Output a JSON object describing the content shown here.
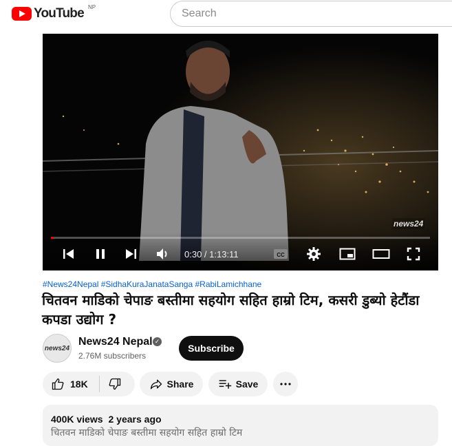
{
  "header": {
    "logo_text": "YouTube",
    "country_code": "NP",
    "search_placeholder": "Search"
  },
  "player": {
    "time_display": "0:30 / 1:13:11",
    "progress_fraction": 0.007,
    "watermark": "news24",
    "controls": [
      "previous-icon",
      "pause-icon",
      "next-icon",
      "volume-icon",
      "captions-icon",
      "settings-icon",
      "miniplayer-icon",
      "theater-icon",
      "fullscreen-icon"
    ]
  },
  "video": {
    "hashtags": "#News24Nepal #SidhaKuraJanataSanga #RabiLamichhane",
    "title": "चितवन माडिको चेपाङ बस्तीमा सहयोग सहित हाम्रो टिम, कसरी डुब्यो हेटौंडा कपडा उद्योग ?"
  },
  "channel": {
    "name": "News24 Nepal",
    "avatar_text": "news24",
    "subscribers": "2.76M subscribers",
    "subscribe_label": "Subscribe"
  },
  "actions": {
    "like_count": "18K",
    "share_label": "Share",
    "save_label": "Save"
  },
  "description": {
    "views": "400K views",
    "age": "2 years ago",
    "first_line": "चितवन माडिको चेपाङ बस्तीमा सहयोग सहित हाम्रो टिम"
  },
  "colors": {
    "brand_red": "#ff0000",
    "link_blue": "#065fd4",
    "button_dark": "#0f0f0f",
    "chip_bg": "#f2f2f2"
  }
}
